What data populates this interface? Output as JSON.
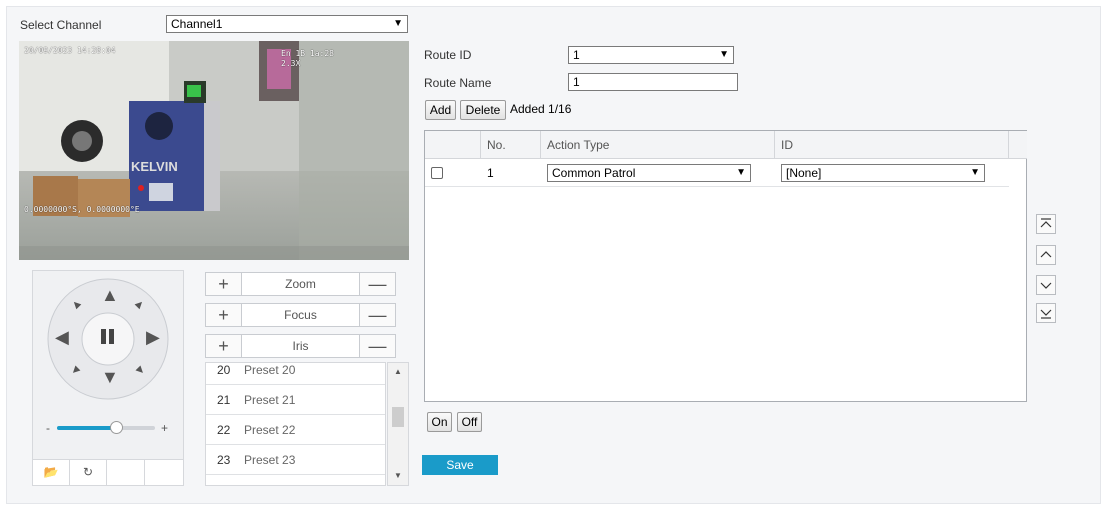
{
  "channel": {
    "label": "Select Channel",
    "value": "Channel1"
  },
  "video": {
    "timestamp": "20/09/2023 14:28:04",
    "coords": "0.0000000°S, 0.0000000°E",
    "overlay_tl": "En 1B 1a:28",
    "overlay_tr": "2.3X",
    "brand_text": "KELVIN"
  },
  "controls": {
    "zoom": "Zoom",
    "focus": "Focus",
    "iris": "Iris",
    "plus": "+",
    "minus": "—"
  },
  "speed": {
    "minus": "-",
    "plus": "+",
    "level": 0.6
  },
  "presets": [
    {
      "no": "20",
      "name": "Preset 20"
    },
    {
      "no": "21",
      "name": "Preset 21"
    },
    {
      "no": "22",
      "name": "Preset 22"
    },
    {
      "no": "23",
      "name": "Preset 23"
    }
  ],
  "route": {
    "id_label": "Route ID",
    "id_value": "1",
    "name_label": "Route Name",
    "name_value": "1"
  },
  "buttons": {
    "add": "Add",
    "delete": "Delete",
    "added": "Added 1/16",
    "on": "On",
    "off": "Off",
    "save": "Save"
  },
  "table": {
    "headers": {
      "no": "No.",
      "action": "Action Type",
      "id": "ID"
    },
    "rows": [
      {
        "no": "1",
        "action": "Common Patrol",
        "id": "[None]"
      }
    ]
  },
  "colors": {
    "save": "#1a9bc9",
    "accent": "#1a9bc9"
  }
}
